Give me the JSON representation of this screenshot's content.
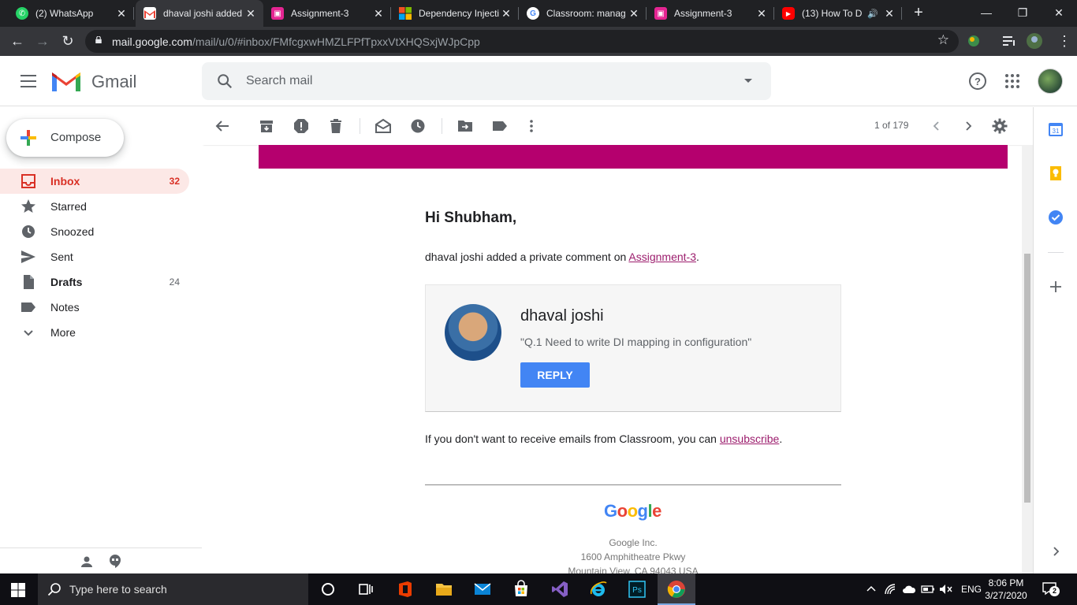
{
  "browser": {
    "tabs": [
      {
        "title": "(2) WhatsApp",
        "icon": "whatsapp-icon",
        "color": "#25d366"
      },
      {
        "title": "dhaval joshi added",
        "icon": "gmail-icon",
        "color": "#ea4335"
      },
      {
        "title": "Assignment-3",
        "icon": "classroom-icon",
        "color": "#e52592"
      },
      {
        "title": "Dependency Injecti",
        "icon": "microsoft-icon",
        "color": "#f25022"
      },
      {
        "title": "Classroom: manag",
        "icon": "google-icon",
        "color": "#4285f4"
      },
      {
        "title": "Assignment-3",
        "icon": "classroom-icon",
        "color": "#e52592"
      },
      {
        "title": "(13) How To D",
        "icon": "youtube-icon",
        "color": "#ff0000"
      }
    ],
    "url_host": "mail.google.com",
    "url_path": "/mail/u/0/#inbox/FMfcgxwHMZLFPfTpxxVtXHQSxjWJpCpp"
  },
  "gmail": {
    "brand": "Gmail",
    "search_placeholder": "Search mail",
    "compose_label": "Compose",
    "nav": [
      {
        "label": "Inbox",
        "count": "32",
        "icon": "inbox-icon"
      },
      {
        "label": "Starred",
        "count": "",
        "icon": "star-icon"
      },
      {
        "label": "Snoozed",
        "count": "",
        "icon": "clock-icon"
      },
      {
        "label": "Sent",
        "count": "",
        "icon": "send-icon"
      },
      {
        "label": "Drafts",
        "count": "24",
        "icon": "draft-icon"
      },
      {
        "label": "Notes",
        "count": "",
        "icon": "label-icon"
      },
      {
        "label": "More",
        "count": "",
        "icon": "chevron-down-icon"
      }
    ],
    "pager": "1 of 179"
  },
  "email": {
    "greeting": "Hi Shubham,",
    "line_prefix": "dhaval joshi added a private comment on ",
    "line_link": "Assignment-3",
    "line_suffix": ".",
    "sender_name": "dhaval joshi",
    "comment": "\"Q.1 Need to write DI mapping in configuration\"",
    "reply_label": "REPLY",
    "unsub_prefix": "If you don't want to receive emails from Classroom, you can ",
    "unsub_link": "unsubscribe",
    "unsub_suffix": ".",
    "footer_brand": "Google",
    "footer_company": "Google Inc.",
    "footer_street": "1600 Amphitheatre Pkwy",
    "footer_city": "Mountain View, CA 94043 USA",
    "banner_color": "#b5006e"
  },
  "taskbar": {
    "search_placeholder": "Type here to search",
    "lang": "ENG",
    "time": "8:06 PM",
    "date": "3/27/2020",
    "notification_count": "2"
  }
}
